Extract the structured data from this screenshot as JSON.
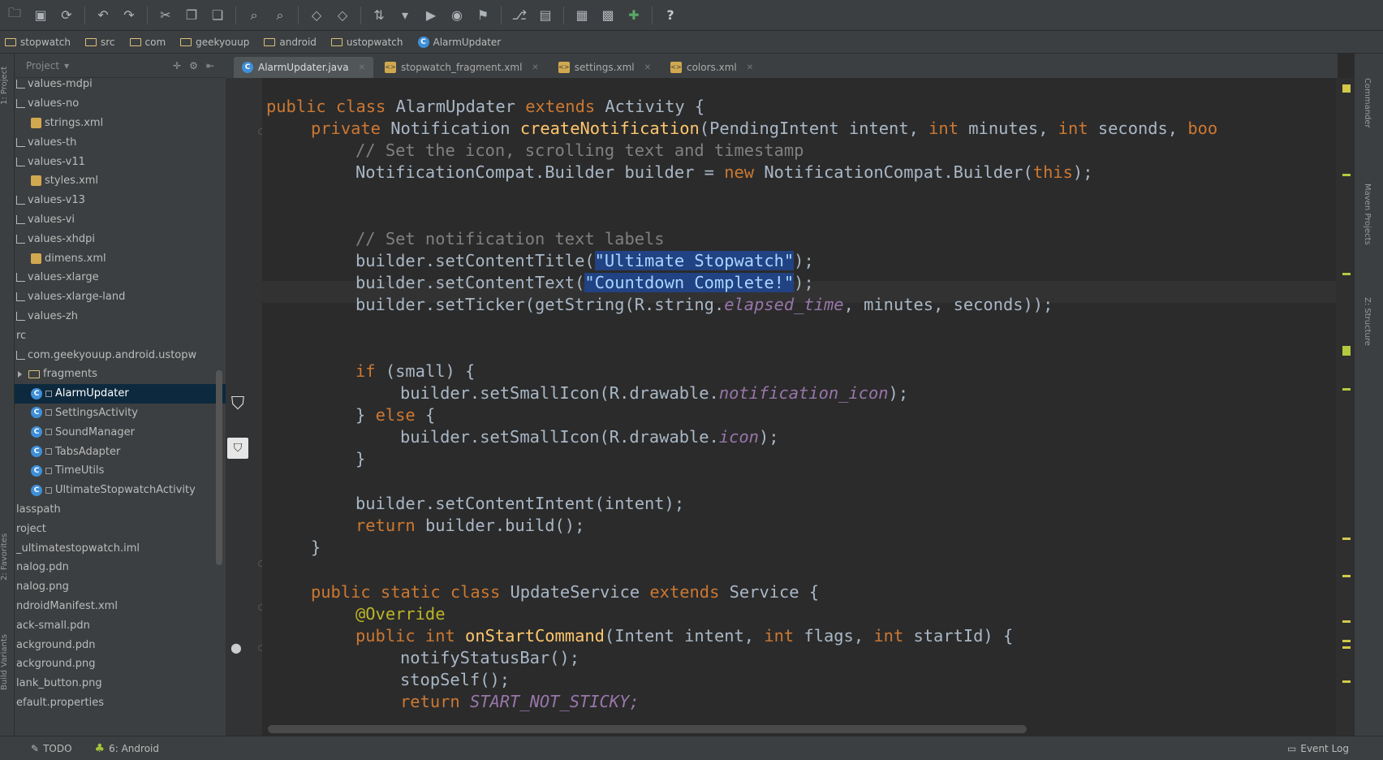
{
  "toolbar": {
    "buttons": [
      "open-icon",
      "save-icon",
      "sync-icon",
      "undo-icon",
      "redo-icon",
      "cut-icon",
      "copy-icon",
      "paste-icon",
      "find-icon",
      "replace-icon",
      "back-icon",
      "forward-icon",
      "make-icon",
      "run-config-icon",
      "run-icon",
      "debug-icon",
      "attach-icon",
      "vcs-icon",
      "sdk-manager-icon",
      "avd-manager-icon",
      "android-device-icon",
      "help-icon"
    ]
  },
  "breadcrumb": {
    "items": [
      {
        "label": "stopwatch",
        "icon": "folder-icon"
      },
      {
        "label": "src",
        "icon": "folder-icon"
      },
      {
        "label": "com",
        "icon": "folder-icon"
      },
      {
        "label": "geekyouup",
        "icon": "folder-icon"
      },
      {
        "label": "android",
        "icon": "folder-icon"
      },
      {
        "label": "ustopwatch",
        "icon": "folder-icon"
      },
      {
        "label": "AlarmUpdater",
        "icon": "class-icon"
      }
    ]
  },
  "left_strip": {
    "project_tab": "1: Project",
    "favorites_tab": "2: Favorites",
    "build_variants_tab": "Build Variants"
  },
  "project_panel": {
    "header": "Project",
    "tree": [
      {
        "label": "values-mdpi",
        "type": "folder",
        "indent": 0
      },
      {
        "label": "values-no",
        "type": "folder",
        "indent": 0
      },
      {
        "label": "strings.xml",
        "type": "xml",
        "indent": 1
      },
      {
        "label": "values-th",
        "type": "folder",
        "indent": 0
      },
      {
        "label": "values-v11",
        "type": "folder",
        "indent": 0
      },
      {
        "label": "styles.xml",
        "type": "xml",
        "indent": 1
      },
      {
        "label": "values-v13",
        "type": "folder",
        "indent": 0
      },
      {
        "label": "values-vi",
        "type": "folder",
        "indent": 0
      },
      {
        "label": "values-xhdpi",
        "type": "folder",
        "indent": 0
      },
      {
        "label": "dimens.xml",
        "type": "xml",
        "indent": 1
      },
      {
        "label": "values-xlarge",
        "type": "folder",
        "indent": 0
      },
      {
        "label": "values-xlarge-land",
        "type": "folder",
        "indent": 0
      },
      {
        "label": "values-zh",
        "type": "folder",
        "indent": 0
      },
      {
        "label": "rc",
        "type": "text",
        "indent": 0
      },
      {
        "label": "com.geekyouup.android.ustopw",
        "type": "folder",
        "indent": 0
      },
      {
        "label": "fragments",
        "type": "package",
        "indent": 0
      },
      {
        "label": "AlarmUpdater",
        "type": "class",
        "indent": 1,
        "selected": true
      },
      {
        "label": "SettingsActivity",
        "type": "class",
        "indent": 1
      },
      {
        "label": "SoundManager",
        "type": "class",
        "indent": 1
      },
      {
        "label": "TabsAdapter",
        "type": "class",
        "indent": 1
      },
      {
        "label": "TimeUtils",
        "type": "class",
        "indent": 1
      },
      {
        "label": "UltimateStopwatchActivity",
        "type": "class",
        "indent": 1
      },
      {
        "label": "lasspath",
        "type": "text",
        "indent": 0
      },
      {
        "label": "roject",
        "type": "text",
        "indent": 0
      },
      {
        "label": "_ultimatestopwatch.iml",
        "type": "text",
        "indent": 0
      },
      {
        "label": "nalog.pdn",
        "type": "text",
        "indent": 0
      },
      {
        "label": "nalog.png",
        "type": "text",
        "indent": 0
      },
      {
        "label": "ndroidManifest.xml",
        "type": "text",
        "indent": 0
      },
      {
        "label": "ack-small.pdn",
        "type": "text",
        "indent": 0
      },
      {
        "label": "ackground.pdn",
        "type": "text",
        "indent": 0
      },
      {
        "label": "ackground.png",
        "type": "text",
        "indent": 0
      },
      {
        "label": "lank_button.png",
        "type": "text",
        "indent": 0
      },
      {
        "label": "efault.properties",
        "type": "text",
        "indent": 0
      }
    ]
  },
  "tabs": [
    {
      "label": "AlarmUpdater.java",
      "icon": "class-icon",
      "active": true
    },
    {
      "label": "stopwatch_fragment.xml",
      "icon": "xml-icon",
      "active": false
    },
    {
      "label": "settings.xml",
      "icon": "xml-icon",
      "active": false
    },
    {
      "label": "colors.xml",
      "icon": "xml-icon",
      "active": false
    }
  ],
  "code": {
    "l1_kw1": "public class ",
    "l1_name": "AlarmUpdater ",
    "l1_kw2": "extends ",
    "l1_rest": "Activity {",
    "l2_kw": "private ",
    "l2_type": "Notification ",
    "l2_fn": "createNotification",
    "l2_a": "(PendingIntent intent, ",
    "l2_kw2": "int ",
    "l2_b": "minutes, ",
    "l2_kw3": "int ",
    "l2_c": "seconds, ",
    "l2_kw4": "boo",
    "l3_cm": "// Set the icon, scrolling text and timestamp",
    "l4_a": "NotificationCompat.Builder builder = ",
    "l4_kw": "new ",
    "l4_b": "NotificationCompat.Builder(",
    "l4_kw2": "this",
    "l4_c": ");",
    "l5_cm": "// Set notification text labels",
    "l6_a": "builder.setContentTitle(",
    "l6_str": "\"Ultimate Stopwatch\"",
    "l6_b": ");",
    "l7_a": "builder.setContentText(",
    "l7_str": "\"Countdown Complete!\"",
    "l7_b": ");",
    "l8_a": "builder.setTicker(getString(R.string.",
    "l8_it": "elapsed_time",
    "l8_b": ", minutes, seconds));",
    "l9_kw": "if ",
    "l9_a": "(small) {",
    "l10_a": "builder.setSmallIcon(R.drawable.",
    "l10_it": "notification_icon",
    "l10_b": ");",
    "l11_a": "} ",
    "l11_kw": "else ",
    "l11_b": "{",
    "l12_a": "builder.setSmallIcon(R.drawable.",
    "l12_it": "icon",
    "l12_b": ");",
    "l13_a": "}",
    "l14_a": "builder.setContentIntent(intent);",
    "l15_kw": "return ",
    "l15_a": "builder.build();",
    "l16_a": "}",
    "l17_kw": "public static class ",
    "l17_name": "UpdateService ",
    "l17_kw2": "extends ",
    "l17_rest": "Service {",
    "l18_ann": "@Override",
    "l19_kw": "public int ",
    "l19_fn": "onStartCommand",
    "l19_a": "(Intent intent, ",
    "l19_kw2": "int ",
    "l19_b": "flags, ",
    "l19_kw3": "int ",
    "l19_c": "startId) {",
    "l20_a": "notifyStatusBar();",
    "l21_a": "stopSelf();",
    "l22_kw": "return ",
    "l22_cst": "START_NOT_STICKY;"
  },
  "right_strip": {
    "commander_tab": "Commander",
    "maven_tab": "Maven Projects",
    "structure_tab": "Z: Structure"
  },
  "statusbar": {
    "todo": "TODO",
    "android": "6: Android",
    "event_log": "Event Log"
  },
  "colors": {
    "keyword": "#cc7832",
    "string": "#6a8759",
    "comment": "#808080",
    "function": "#ffc66d",
    "field": "#9876aa",
    "selection": "#214283"
  }
}
